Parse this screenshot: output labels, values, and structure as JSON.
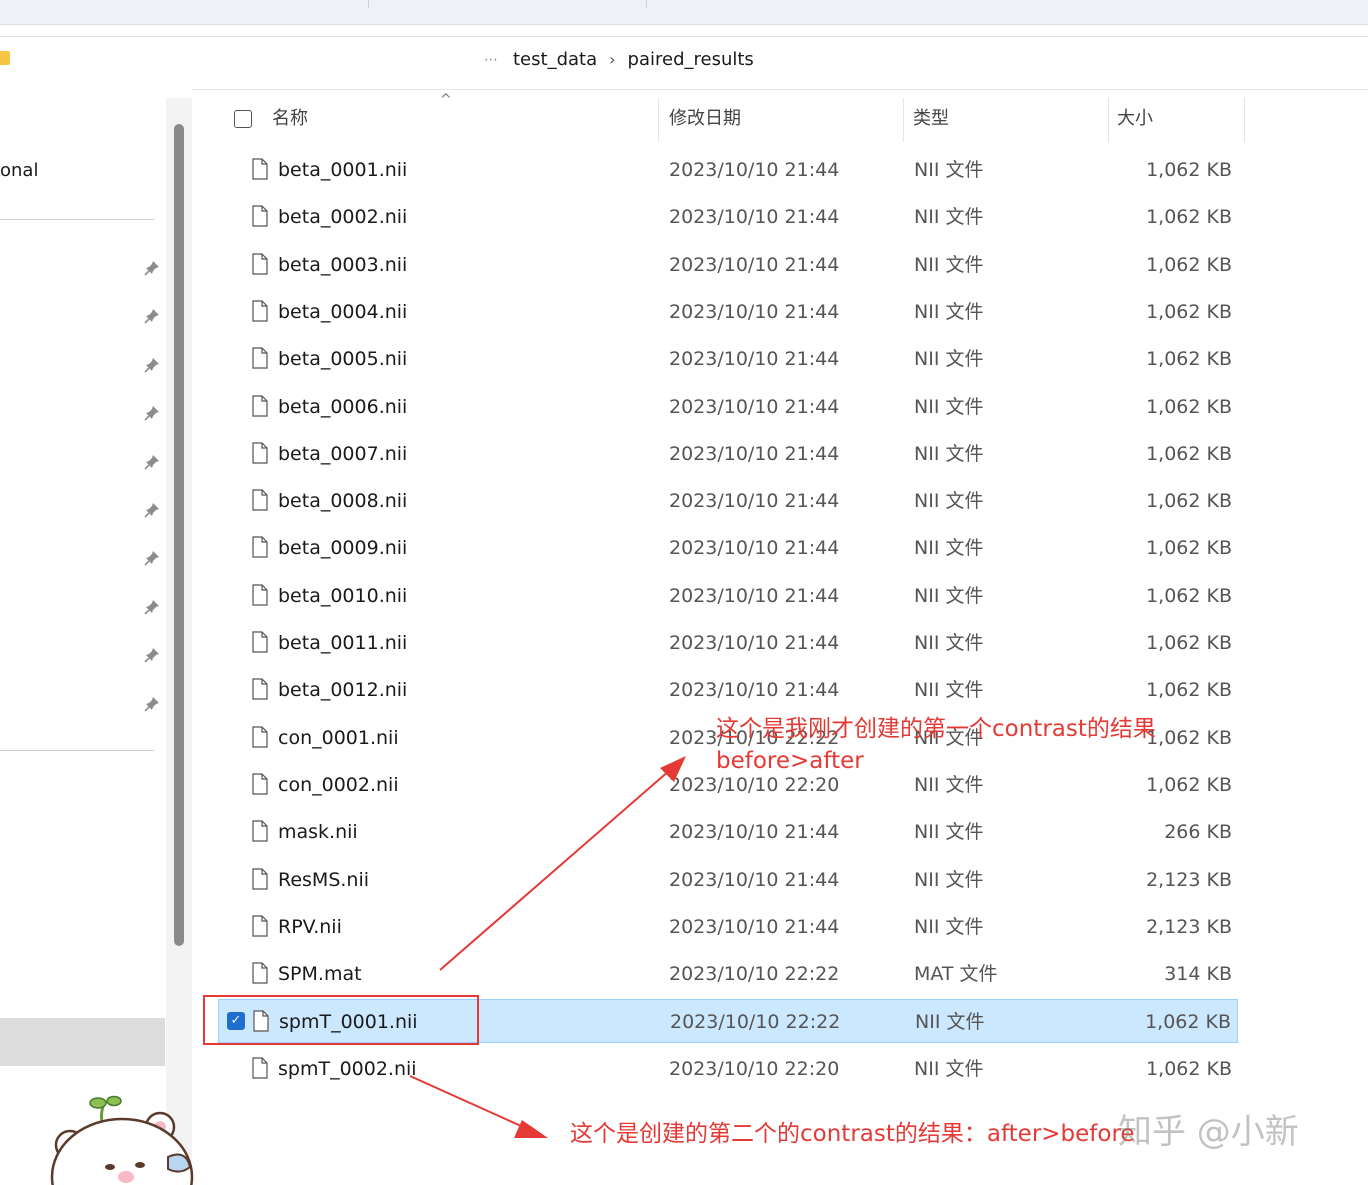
{
  "breadcrumb": {
    "dots": "⋯",
    "items": [
      "test_data",
      "paired_results"
    ],
    "separator": "›"
  },
  "nav": {
    "partial_item": "onal",
    "pinned_count": 10
  },
  "columns": {
    "name": "名称",
    "date": "修改日期",
    "type": "类型",
    "size": "大小"
  },
  "files": [
    {
      "name": "beta_0001.nii",
      "date": "2023/10/10 21:44",
      "type": "NII 文件",
      "size": "1,062 KB",
      "selected": false
    },
    {
      "name": "beta_0002.nii",
      "date": "2023/10/10 21:44",
      "type": "NII 文件",
      "size": "1,062 KB",
      "selected": false
    },
    {
      "name": "beta_0003.nii",
      "date": "2023/10/10 21:44",
      "type": "NII 文件",
      "size": "1,062 KB",
      "selected": false
    },
    {
      "name": "beta_0004.nii",
      "date": "2023/10/10 21:44",
      "type": "NII 文件",
      "size": "1,062 KB",
      "selected": false
    },
    {
      "name": "beta_0005.nii",
      "date": "2023/10/10 21:44",
      "type": "NII 文件",
      "size": "1,062 KB",
      "selected": false
    },
    {
      "name": "beta_0006.nii",
      "date": "2023/10/10 21:44",
      "type": "NII 文件",
      "size": "1,062 KB",
      "selected": false
    },
    {
      "name": "beta_0007.nii",
      "date": "2023/10/10 21:44",
      "type": "NII 文件",
      "size": "1,062 KB",
      "selected": false
    },
    {
      "name": "beta_0008.nii",
      "date": "2023/10/10 21:44",
      "type": "NII 文件",
      "size": "1,062 KB",
      "selected": false
    },
    {
      "name": "beta_0009.nii",
      "date": "2023/10/10 21:44",
      "type": "NII 文件",
      "size": "1,062 KB",
      "selected": false
    },
    {
      "name": "beta_0010.nii",
      "date": "2023/10/10 21:44",
      "type": "NII 文件",
      "size": "1,062 KB",
      "selected": false
    },
    {
      "name": "beta_0011.nii",
      "date": "2023/10/10 21:44",
      "type": "NII 文件",
      "size": "1,062 KB",
      "selected": false
    },
    {
      "name": "beta_0012.nii",
      "date": "2023/10/10 21:44",
      "type": "NII 文件",
      "size": "1,062 KB",
      "selected": false
    },
    {
      "name": "con_0001.nii",
      "date": "2023/10/10 22:22",
      "type": "NII 文件",
      "size": "1,062 KB",
      "selected": false
    },
    {
      "name": "con_0002.nii",
      "date": "2023/10/10 22:20",
      "type": "NII 文件",
      "size": "1,062 KB",
      "selected": false
    },
    {
      "name": "mask.nii",
      "date": "2023/10/10 21:44",
      "type": "NII 文件",
      "size": "266 KB",
      "selected": false
    },
    {
      "name": "ResMS.nii",
      "date": "2023/10/10 21:44",
      "type": "NII 文件",
      "size": "2,123 KB",
      "selected": false
    },
    {
      "name": "RPV.nii",
      "date": "2023/10/10 21:44",
      "type": "NII 文件",
      "size": "2,123 KB",
      "selected": false
    },
    {
      "name": "SPM.mat",
      "date": "2023/10/10 22:22",
      "type": "MAT 文件",
      "size": "314 KB",
      "selected": false
    },
    {
      "name": "spmT_0001.nii",
      "date": "2023/10/10 22:22",
      "type": "NII 文件",
      "size": "1,062 KB",
      "selected": true
    },
    {
      "name": "spmT_0002.nii",
      "date": "2023/10/10 22:20",
      "type": "NII 文件",
      "size": "1,062 KB",
      "selected": false
    }
  ],
  "annotations": {
    "first_line1": "这个是我刚才创建的第一个contrast的结果",
    "first_line2": "before>after",
    "second": "这个是创建的第二个的contrast的结果：after>before"
  },
  "watermark": "知乎 @小新",
  "colors": {
    "annotation": "#e53935",
    "selection_bg": "#cce8ff",
    "checkbox_checked": "#1f6fce"
  }
}
